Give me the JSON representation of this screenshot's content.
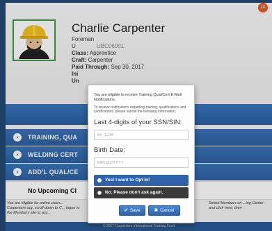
{
  "profile": {
    "name": "Charlie Carpenter",
    "title": "Foreman",
    "id_prefix": "U",
    "id_suffix": "UBC06001",
    "class_label": "Class:",
    "class_value": "Apprentice",
    "craft_label": "Craft:",
    "craft_value": "Carpenter",
    "paid_label": "Paid Through:",
    "paid_value": "Sep 30, 2017",
    "ini_label": "Ini",
    "un_label": "Un",
    "badge": "10"
  },
  "sections": [
    {
      "label": "TRAINING, QUA"
    },
    {
      "label": "WELDING CERT"
    },
    {
      "label": "ADD'L QUAL/CE"
    }
  ],
  "upcoming": "No Upcoming Cl",
  "footer": {
    "left_note": "You are eligible for online cours... Carpenters.org, scroll down to C... logon to the Members site to acc...",
    "right_note": "Select Members on ...ing Center and click here, then",
    "copyright": "© 2017 Carpenters International Training Fund"
  },
  "modal": {
    "intro": "You are eligible to receive Training Qual/Cert E-Mail Notifications.",
    "intro_sub": "To receive notifications regarding training, qualifications and certifications, please submit the following information:",
    "ssn_label": "Last 4-digits of your SSN/SIN:",
    "ssn_placeholder": "ex. 1234",
    "birth_label": "Birth Date:",
    "birth_placeholder": "MM/DD/YYYY",
    "opt_yes": "Yes! I want to Opt In!",
    "opt_no": "No. Please don't ask again.",
    "save": "Save",
    "cancel": "Cancel"
  },
  "colors": {
    "primary": "#2f62a8",
    "band": "#3a74b8",
    "dark_option": "#3a3a3a",
    "avatar_border": "#3b9a3b"
  }
}
